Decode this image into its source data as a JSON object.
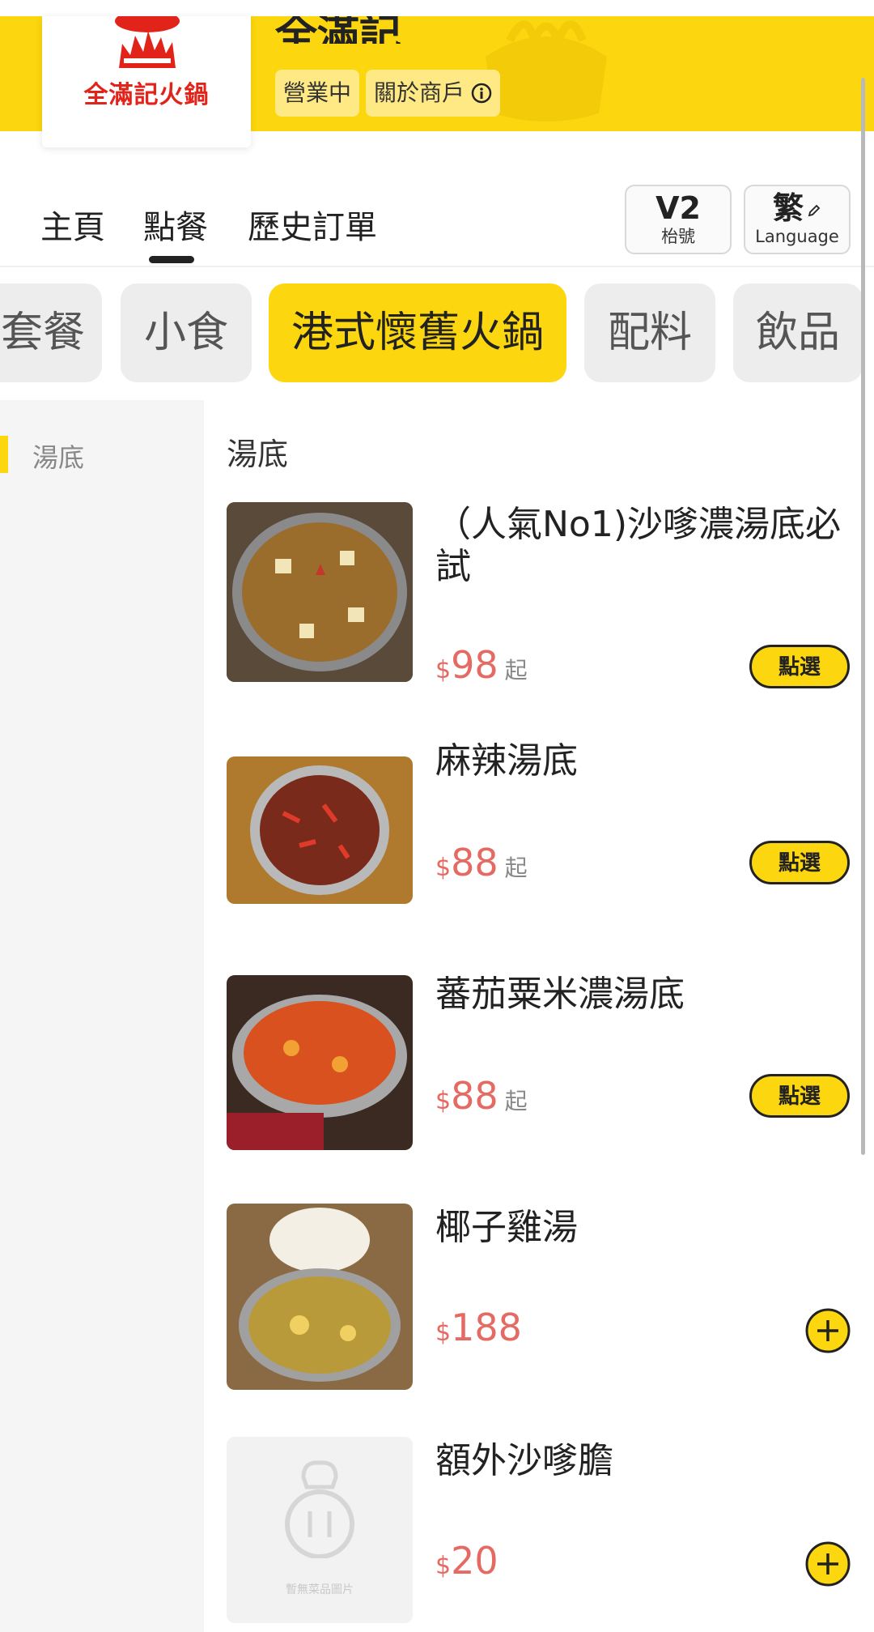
{
  "header": {
    "logo_text": "全滿記火鍋",
    "store_name": "全滿記",
    "status_chip": "營業中",
    "about_chip": "關於商戶",
    "about_icon": "info-icon",
    "brand_color": "#FCD60E"
  },
  "nav": {
    "tabs": [
      "主頁",
      "點餐",
      "歷史訂單"
    ],
    "active_tab": "點餐",
    "table": {
      "number": "V2",
      "label": "枱號"
    },
    "language": {
      "value": "繁",
      "label": "Language",
      "icon": "pencil-icon"
    }
  },
  "categories": {
    "items": [
      "套餐",
      "小食",
      "港式懷舊火鍋",
      "配料",
      "飲品"
    ],
    "active": "港式懷舊火鍋"
  },
  "sidebar": {
    "items": [
      "湯底"
    ],
    "active": "湯底"
  },
  "menu": {
    "section_title": "湯底",
    "items": [
      {
        "name": "（人氣No1)沙嗲濃湯底必試",
        "currency": "$",
        "price": "98",
        "suffix": "起",
        "action": "點選",
        "image": "satay-soup-photo"
      },
      {
        "name": "麻辣湯底",
        "currency": "$",
        "price": "88",
        "suffix": "起",
        "action": "點選",
        "image": "mala-soup-photo"
      },
      {
        "name": "蕃茄粟米濃湯底",
        "currency": "$",
        "price": "88",
        "suffix": "起",
        "action": "點選",
        "image": "tomato-corn-soup-photo"
      },
      {
        "name": "椰子雞湯",
        "currency": "$",
        "price": "188",
        "action_icon": "plus-icon",
        "image": "coconut-chicken-soup-photo"
      },
      {
        "name": "額外沙嗲膽",
        "currency": "$",
        "price": "20",
        "action_icon": "plus-icon",
        "image": "no-image-placeholder",
        "placeholder_text": "暫無菜品圖片"
      }
    ],
    "price_color": "#E46A63"
  }
}
